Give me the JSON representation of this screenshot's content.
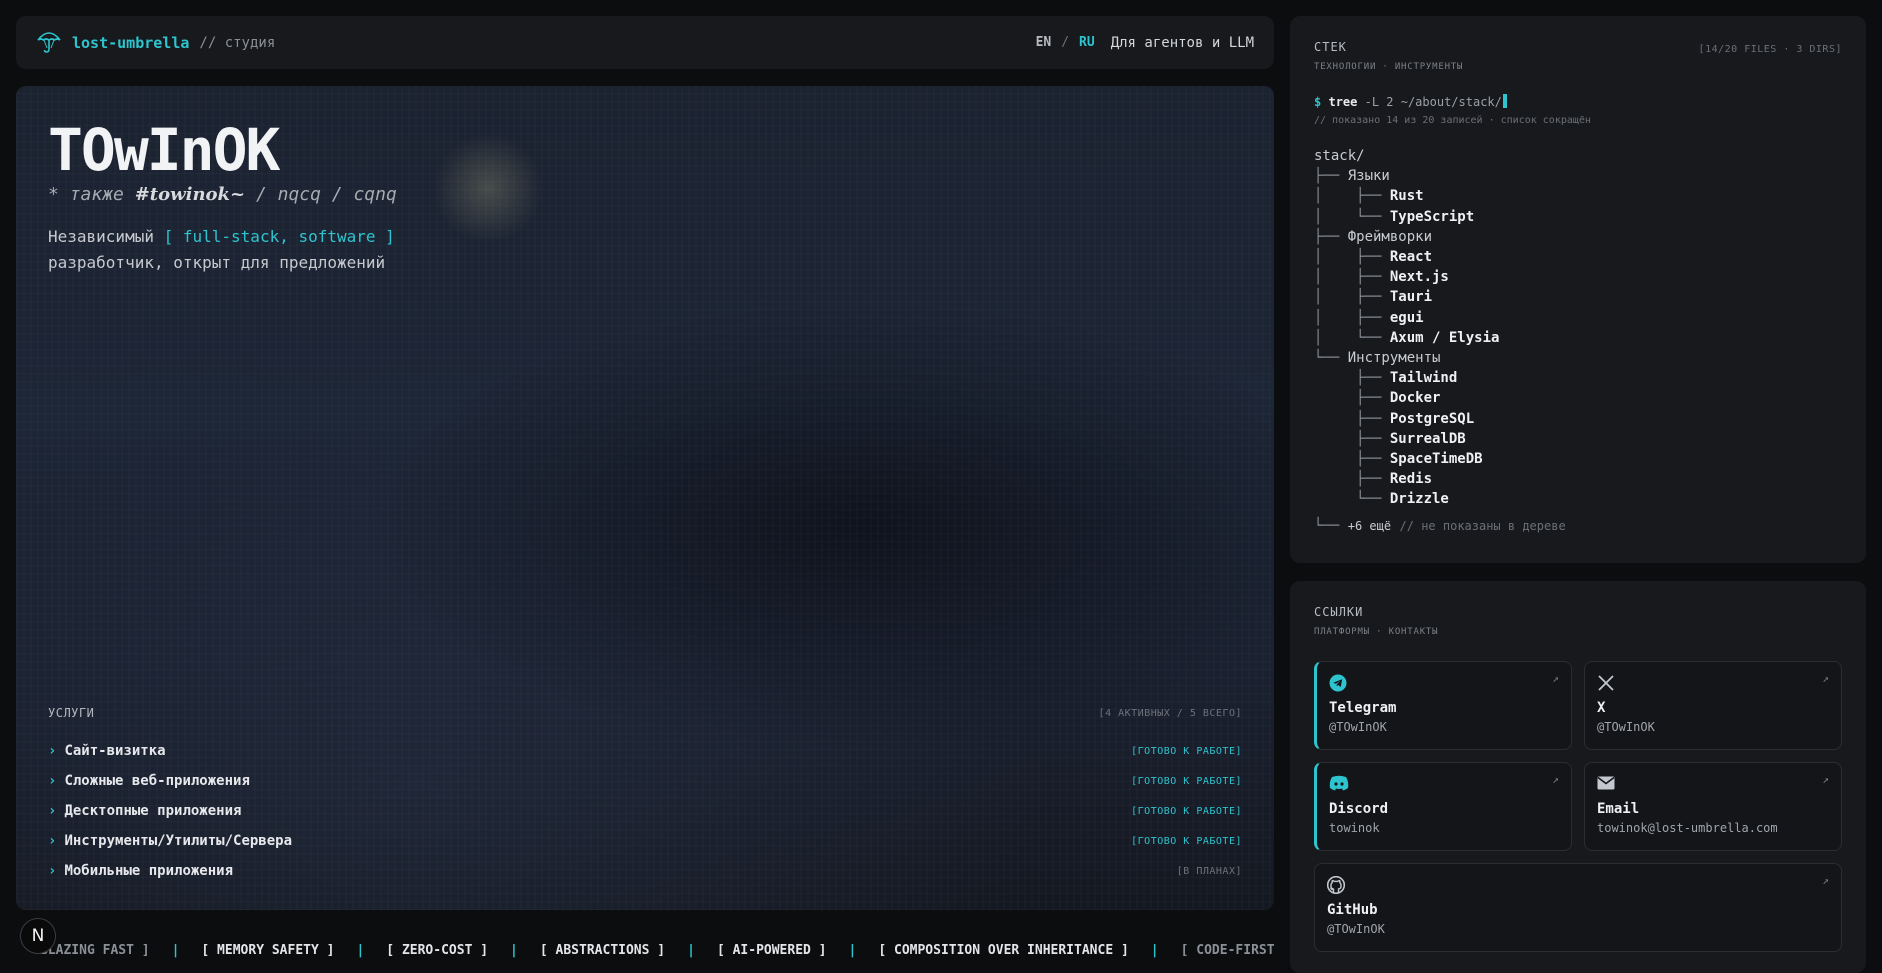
{
  "header": {
    "brand": "lost-umbrella",
    "brand_suffix": "// студия",
    "lang_en": "EN",
    "lang_sep": "/",
    "lang_ru": "RU",
    "agents_link": "Для агентов и LLM"
  },
  "hero": {
    "title": "TOwInOK",
    "aka_prefix": "* также",
    "aka_script": "#towinok~",
    "aka_rest": "/ nqcq / cqnq",
    "desc_1": "Независимый",
    "desc_highlight": "[ full-stack, software ]",
    "desc_2": "разработчик, открыт для предложений"
  },
  "services": {
    "label": "УСЛУГИ",
    "count": "[4 АКТИВНЫХ / 5 ВСЕГО]",
    "items": [
      {
        "name": "Сайт-визитка",
        "status": "[ГОТОВО К РАБОТЕ]"
      },
      {
        "name": "Сложные веб-приложения",
        "status": "[ГОТОВО К РАБОТЕ]"
      },
      {
        "name": "Десктопные приложения",
        "status": "[ГОТОВО К РАБОТЕ]"
      },
      {
        "name": "Инструменты/Утилиты/Сервера",
        "status": "[ГОТОВО К РАБОТЕ]"
      },
      {
        "name": "Мобильные приложения",
        "status": "[В ПЛАНАХ]"
      }
    ]
  },
  "ticker": {
    "items": [
      "BLAZING FAST ]",
      "[ MEMORY SAFETY ]",
      "[ ZERO-COST ]",
      "[ ABSTRACTIONS ]",
      "[ AI-POWERED ]",
      "[ COMPOSITION OVER INHERITANCE ]",
      "[ CODE-FIRST"
    ],
    "separator": "|"
  },
  "badge": "N",
  "stack": {
    "title": "СТЕК",
    "subtitle": "ТЕХНОЛОГИИ · ИНСТРУМЕНТЫ",
    "meta": "[14/20 FILES · 3 DIRS]",
    "prompt": "$",
    "cmd_kw": "tree",
    "cmd_args": "-L 2 ~/about/stack/",
    "cmd_note": "// показано 14 из 20 записей · список сокращён",
    "root": "stack/",
    "groups": [
      {
        "name": "Языки",
        "items": [
          "Rust",
          "TypeScript"
        ]
      },
      {
        "name": "Фреймворки",
        "items": [
          "React",
          "Next.js",
          "Tauri",
          "egui",
          "Axum / Elysia"
        ]
      },
      {
        "name": "Инструменты",
        "items": [
          "Tailwind",
          "Docker",
          "PostgreSQL",
          "SurrealDB",
          "SpaceTimeDB",
          "Redis",
          "Drizzle"
        ]
      }
    ],
    "more": "+6 ещё",
    "more_note": "// не показаны в дереве"
  },
  "links": {
    "title": "ССЫЛКИ",
    "subtitle": "ПЛАТФОРМЫ · КОНТАКТЫ",
    "arrow": "↗",
    "items": [
      {
        "name": "Telegram",
        "handle": "@TOwInOK",
        "icon": "telegram-icon"
      },
      {
        "name": "X",
        "handle": "@TOwInOK",
        "icon": "x-icon"
      },
      {
        "name": "Discord",
        "handle": "towinok",
        "icon": "discord-icon"
      },
      {
        "name": "Email",
        "handle": "towinok@lost-umbrella.com",
        "icon": "mail-icon"
      },
      {
        "name": "GitHub",
        "handle": "@TOwInOK",
        "icon": "github-icon"
      }
    ]
  },
  "colors": {
    "accent": "#2ec4cf",
    "background": "#0c0d0f",
    "panel": "#17191c"
  }
}
